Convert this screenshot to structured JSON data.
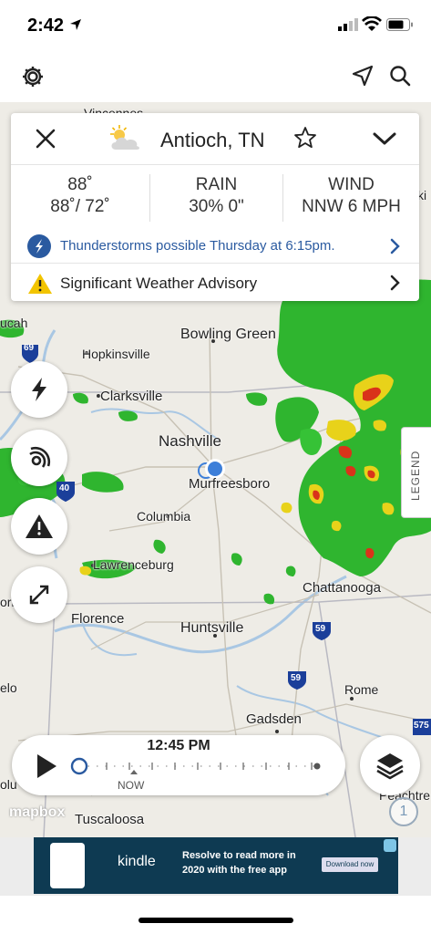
{
  "status_bar": {
    "time": "2:42"
  },
  "map_labels": {
    "vincennes": "Vincennes",
    "paducah": "ucah",
    "hopkinsville": "Hopkinsville",
    "bowling_green": "Bowling Green",
    "clarksville": "Clarksville",
    "nashville": "Nashville",
    "murfreesboro": "Murfreesboro",
    "columbia": "Columbia",
    "lawrenceburg": "Lawrenceburg",
    "chattanooga": "Chattanooga",
    "florence": "Florence",
    "huntsville": "Huntsville",
    "rome": "Rome",
    "gadsden": "Gadsden",
    "tuscaloosa": "Tuscaloosa",
    "peachtree": "Peachtre",
    "left_edge_ori": "ori",
    "left_edge_elo": "elo",
    "left_edge_olu": "olu",
    "right_edge_ki": "ki",
    "hwy_69": "69",
    "hwy_40": "40",
    "hwy_59a": "59",
    "hwy_59b": "59",
    "hwy_575": "575"
  },
  "card": {
    "location": "Antioch, TN",
    "current_temp": "88˚",
    "hi_lo": "88˚/ 72˚",
    "rain_label": "RAIN",
    "rain_value": "30% 0\"",
    "wind_label": "WIND",
    "wind_value": "NNW 6 MPH",
    "alert_text": "Thunderstorms possible Thursday at 6:15pm.",
    "advisory_text": "Significant Weather Advisory"
  },
  "legend_label": "LEGEND",
  "player": {
    "time": "12:45 PM",
    "now_label": "NOW"
  },
  "attribution": "mapbox",
  "info_badge": "1",
  "ad": {
    "brand": "kindle",
    "line1": "Resolve to read more in",
    "line2": "2020 with the free app",
    "cta": "Download now"
  },
  "colors": {
    "accent_blue": "#2a5aa0",
    "radar_green": "#2fb52f",
    "radar_yellow": "#e8d21a",
    "radar_red": "#d9331a",
    "warning_yellow": "#f2c400",
    "location_dot": "#3d7fd9"
  },
  "icons": [
    "location-arrow-icon",
    "signal-icon",
    "wifi-icon",
    "battery-icon",
    "gear-icon",
    "navigation-icon",
    "search-icon",
    "close-icon",
    "partly-sunny-icon",
    "star-icon",
    "chevron-down-icon",
    "lightning-icon",
    "radar-icon",
    "warning-icon",
    "expand-icon",
    "play-icon",
    "layers-icon"
  ]
}
